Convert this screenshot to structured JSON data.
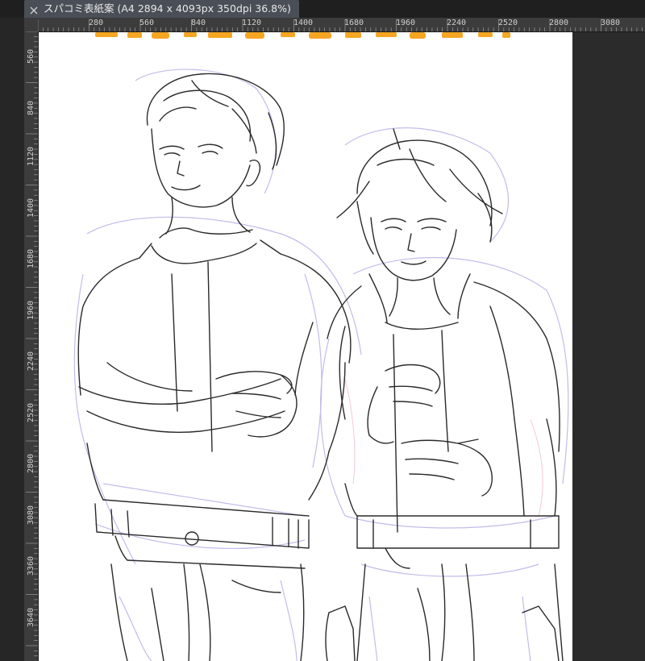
{
  "tab": {
    "close_icon": "close-icon",
    "title": "スパコミ表紙案 (A4 2894 x 4093px 350dpi 36.8%)"
  },
  "ruler": {
    "horizontal_labels": [
      "280",
      "560",
      "840",
      "1120",
      "1400",
      "1680",
      "1960",
      "2240",
      "2520",
      "2800",
      "3080"
    ],
    "vertical_labels": [
      "560",
      "840",
      "1120",
      "1400",
      "1680",
      "1960",
      "2240",
      "2520",
      "2800",
      "3080",
      "3360",
      "3640"
    ]
  },
  "colors": {
    "accent_tab": "#4a4f57",
    "title_text": "#f5a623",
    "sketch_line": "#2a2a2a",
    "under_sketch": "#b8b0e8",
    "under_sketch_pink": "#f0b0c8"
  }
}
